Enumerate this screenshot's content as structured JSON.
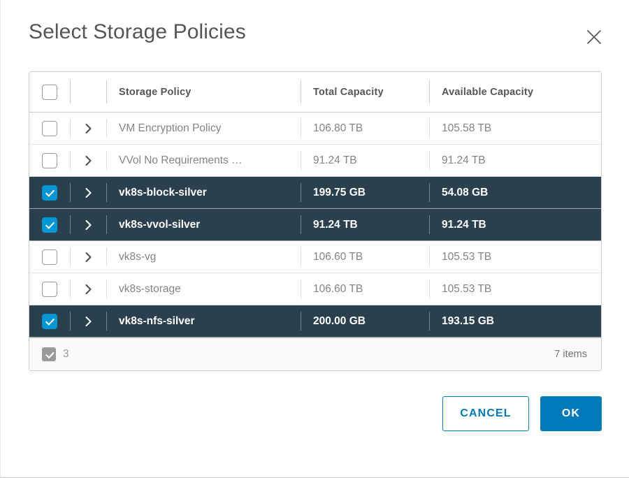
{
  "dialog": {
    "title": "Select Storage Policies",
    "close_icon": "close-icon"
  },
  "table": {
    "columns": [
      {
        "key": "check",
        "label": ""
      },
      {
        "key": "expand",
        "label": ""
      },
      {
        "key": "name",
        "label": "Storage Policy"
      },
      {
        "key": "total",
        "label": "Total Capacity"
      },
      {
        "key": "available",
        "label": "Available Capacity"
      }
    ],
    "rows": [
      {
        "selected": false,
        "name": "VM Encryption Policy",
        "total": "106.80 TB",
        "available": "105.58 TB"
      },
      {
        "selected": false,
        "name": "VVol No Requirements …",
        "total": "91.24 TB",
        "available": "91.24 TB"
      },
      {
        "selected": true,
        "name": "vk8s-block-silver",
        "total": "199.75 GB",
        "available": "54.08 GB"
      },
      {
        "selected": true,
        "name": "vk8s-vvol-silver",
        "total": "91.24 TB",
        "available": "91.24 TB"
      },
      {
        "selected": false,
        "name": "vk8s-vg",
        "total": "106.60 TB",
        "available": "105.53 TB"
      },
      {
        "selected": false,
        "name": "vk8s-storage",
        "total": "106.60 TB",
        "available": "105.53 TB"
      },
      {
        "selected": true,
        "name": "vk8s-nfs-silver",
        "total": "200.00 GB",
        "available": "193.15 GB"
      }
    ],
    "footer": {
      "selected_count": "3",
      "items_count": "7 items"
    }
  },
  "actions": {
    "cancel_label": "CANCEL",
    "ok_label": "OK"
  },
  "colors": {
    "accent_blue": "#0079b8",
    "checkbox_blue": "#0095d3",
    "selected_row": "#2a404f",
    "text": "#565656",
    "muted_text": "#848484"
  }
}
